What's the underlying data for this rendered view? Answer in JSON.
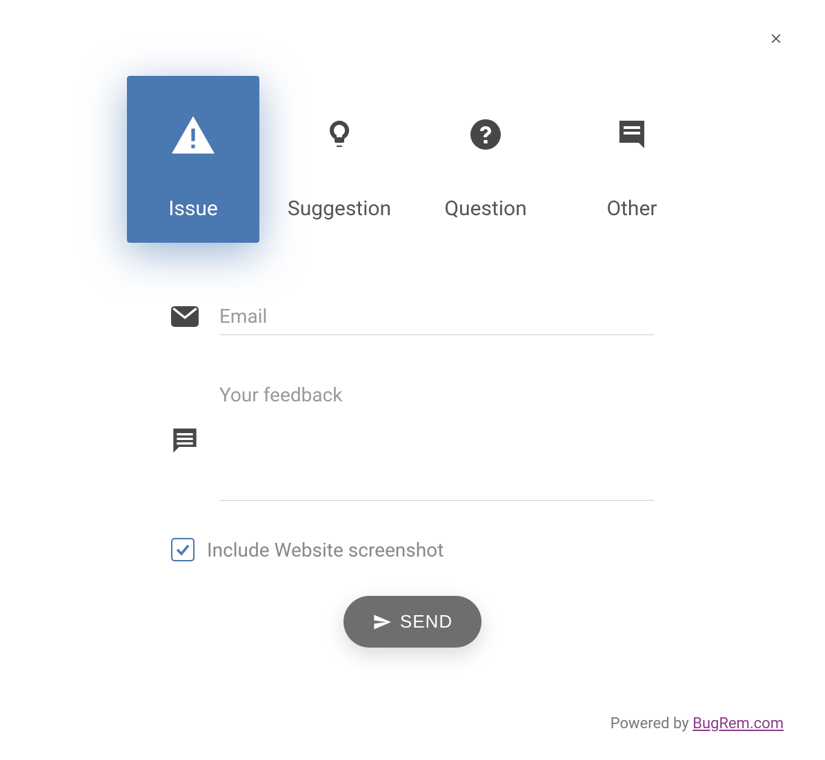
{
  "close_icon": "close",
  "tabs": [
    {
      "label": "Issue",
      "icon": "warning",
      "active": true
    },
    {
      "label": "Suggestion",
      "icon": "lightbulb",
      "active": false
    },
    {
      "label": "Question",
      "icon": "question",
      "active": false
    },
    {
      "label": "Other",
      "icon": "comment",
      "active": false
    }
  ],
  "fields": {
    "email": {
      "placeholder": "Email",
      "value": ""
    },
    "feedback": {
      "placeholder": "Your feedback",
      "value": ""
    }
  },
  "checkbox": {
    "label": "Include Website screenshot",
    "checked": true
  },
  "send_label": "SEND",
  "footer": {
    "prefix": "Powered by ",
    "link_text": "BugRem.com"
  },
  "colors": {
    "accent": "#4A78B0",
    "button": "#6e6e6e",
    "icon": "#474747"
  }
}
